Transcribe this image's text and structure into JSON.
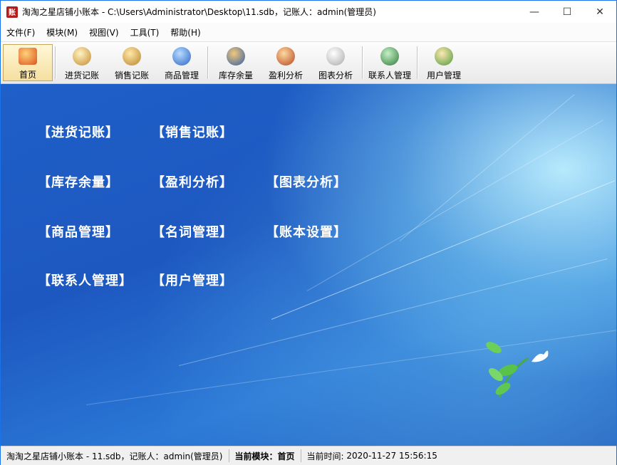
{
  "window": {
    "title": "淘淘之星店铺小账本 - C:\\Users\\Administrator\\Desktop\\11.sdb，记账人：admin(管理员)",
    "icon_text": "账",
    "controls": {
      "minimize": "—",
      "maximize": "☐",
      "close": "✕"
    }
  },
  "menu": {
    "items": [
      {
        "label": "文件(F)"
      },
      {
        "label": "模块(M)"
      },
      {
        "label": "视图(V)"
      },
      {
        "label": "工具(T)"
      },
      {
        "label": "帮助(H)"
      }
    ]
  },
  "toolbar": {
    "items": [
      {
        "label": "首页",
        "icon": "home-icon",
        "active": true
      },
      {
        "label": "进货记账",
        "icon": "purchase-icon"
      },
      {
        "label": "销售记账",
        "icon": "sales-icon"
      },
      {
        "label": "商品管理",
        "icon": "goods-icon"
      },
      {
        "label": "库存余量",
        "icon": "inventory-icon"
      },
      {
        "label": "盈利分析",
        "icon": "profit-icon"
      },
      {
        "label": "图表分析",
        "icon": "chart-icon"
      },
      {
        "label": "联系人管理",
        "icon": "contacts-icon"
      },
      {
        "label": "用户管理",
        "icon": "users-icon"
      }
    ]
  },
  "home": {
    "links": [
      "【进货记账】",
      "【销售记账】",
      "【库存余量】",
      "【盈利分析】",
      "【图表分析】",
      "【商品管理】",
      "【名词管理】",
      "【账本设置】",
      "【联系人管理】",
      "【用户管理】"
    ]
  },
  "status": {
    "file": "淘淘之星店铺小账本 - 11.sdb，记账人：admin(管理员)",
    "module_label": "当前模块：",
    "module_value": "首页",
    "time_label": "当前时间:",
    "time_value": "2020-11-27 15:56:15"
  },
  "colors": {
    "accent": "#1f5fc8",
    "link_text": "#ffffff",
    "title_icon_bg": "#b71c1c"
  }
}
